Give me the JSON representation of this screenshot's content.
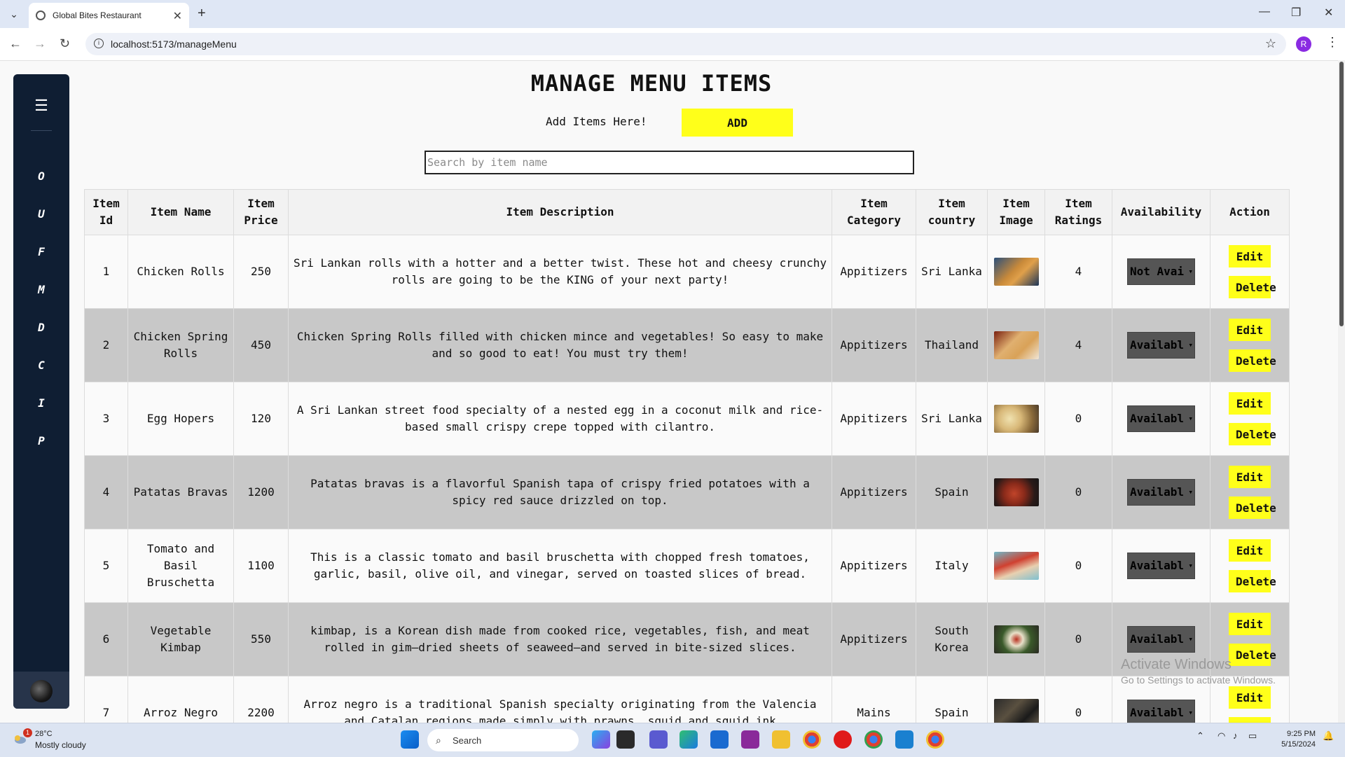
{
  "browser": {
    "tab_title": "Global Bites Restaurant",
    "url": "localhost:5173/manageMenu",
    "profile_initial": "R"
  },
  "sidebar": {
    "items": [
      "O",
      "U",
      "F",
      "M",
      "D",
      "C",
      "I",
      "P"
    ]
  },
  "page": {
    "title": "MANAGE MENU ITEMS",
    "add_label": "Add Items Here!",
    "add_button": "ADD",
    "search_placeholder": "Search by item name"
  },
  "table": {
    "headers": [
      "Item Id",
      "Item Name",
      "Item Price",
      "Item Description",
      "Item Category",
      "Item country",
      "Item Image",
      "Item Ratings",
      "Availability",
      "Action"
    ],
    "rows": [
      {
        "id": "1",
        "name": "Chicken Rolls",
        "price": "250",
        "description": "Sri Lankan rolls with a hotter and a better twist. These hot and cheesy crunchy rolls are going to be the KING of your next party!",
        "category": "Appitizers",
        "country": "Sri Lanka",
        "rating": "4",
        "availability": "Not Avai",
        "edit": "Edit",
        "delete": "Delete"
      },
      {
        "id": "2",
        "name": "Chicken Spring Rolls",
        "price": "450",
        "description": "Chicken Spring Rolls filled with chicken mince and vegetables! So easy to make and so good to eat! You must try them!",
        "category": "Appitizers",
        "country": "Thailand",
        "rating": "4",
        "availability": "Availabl",
        "edit": "Edit",
        "delete": "Delete"
      },
      {
        "id": "3",
        "name": "Egg Hopers",
        "price": "120",
        "description": "A Sri Lankan street food specialty of a nested egg in a coconut milk and rice-based small crispy crepe topped with cilantro.",
        "category": "Appitizers",
        "country": "Sri Lanka",
        "rating": "0",
        "availability": "Availabl",
        "edit": "Edit",
        "delete": "Delete"
      },
      {
        "id": "4",
        "name": "Patatas Bravas",
        "price": "1200",
        "description": "Patatas bravas is a flavorful Spanish tapa of crispy fried potatoes with a spicy red sauce drizzled on top.",
        "category": "Appitizers",
        "country": "Spain",
        "rating": "0",
        "availability": "Availabl",
        "edit": "Edit",
        "delete": "Delete"
      },
      {
        "id": "5",
        "name": "Tomato and Basil Bruschetta",
        "price": "1100",
        "description": "This is a classic tomato and basil bruschetta with chopped fresh tomatoes, garlic, basil, olive oil, and vinegar, served on toasted slices of bread.",
        "category": "Appitizers",
        "country": "Italy",
        "rating": "0",
        "availability": "Availabl",
        "edit": "Edit",
        "delete": "Delete"
      },
      {
        "id": "6",
        "name": "Vegetable Kimbap",
        "price": "550",
        "description": "kimbap, is a Korean dish made from cooked rice, vegetables, fish, and meat rolled in gim—dried sheets of seaweed—and served in bite-sized slices.",
        "category": "Appitizers",
        "country": "South Korea",
        "rating": "0",
        "availability": "Availabl",
        "edit": "Edit",
        "delete": "Delete"
      },
      {
        "id": "7",
        "name": "Arroz Negro",
        "price": "2200",
        "description": "Arroz negro is a traditional Spanish specialty originating from the Valencia and Catalan regions made simply with prawns, squid and squid ink",
        "category": "Mains",
        "country": "Spain",
        "rating": "0",
        "availability": "Availabl",
        "edit": "Edit",
        "delete": "Delete"
      }
    ]
  },
  "watermark": {
    "title": "Activate Windows",
    "subtitle": "Go to Settings to activate Windows."
  },
  "taskbar": {
    "weather_temp": "28°C",
    "weather_condition": "Mostly cloudy",
    "weather_badge": "1",
    "search_label": "Search",
    "time": "9:25 PM",
    "date": "5/15/2024"
  },
  "colors": {
    "sidebar_bg": "#0f1e33",
    "accent_yellow": "#ffff1a",
    "row_alt": "#c8c8c8",
    "select_bg": "#555555"
  }
}
